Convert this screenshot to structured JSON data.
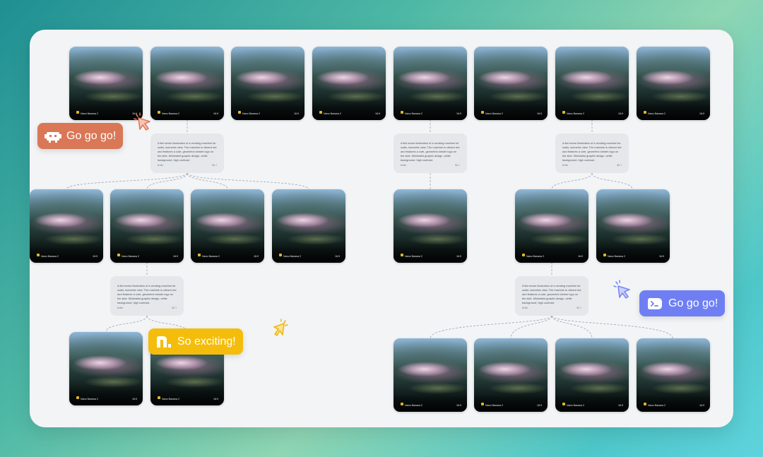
{
  "card": {
    "model": "Nano Banana 2",
    "tag": "16:9"
  },
  "prompt": {
    "text": "A flat vector illustration of a vending machine for sodis, isometric view. The machine is vibrant red and features a cute, geometric lobster logo on the side. Minimalist graphic design, white background, high contrast.",
    "footer_left": "⧉ Mo",
    "footer_right": "$1.?"
  },
  "pills": {
    "red": "Go go go!",
    "blue": "Go go go!",
    "yellow": "So exciting!"
  },
  "colors": {
    "red_pill": "#d97757",
    "blue_pill": "#6f7ff3",
    "yellow_pill": "#f5bd0b",
    "cursor_red": "#e0785a",
    "cursor_blue": "#7a89f2",
    "cursor_yellow": "#f2b705"
  },
  "icons": [
    "robot-icon",
    "terminal-icon",
    "n-logo-icon",
    "cursor-icon",
    "sparkle-icon"
  ]
}
